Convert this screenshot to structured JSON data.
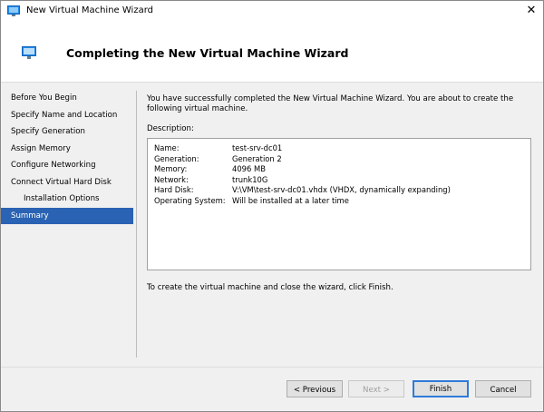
{
  "window": {
    "title": "New Virtual Machine Wizard",
    "close_glyph": "✕"
  },
  "header": {
    "title": "Completing the New Virtual Machine Wizard"
  },
  "sidebar": {
    "items": [
      {
        "label": "Before You Begin"
      },
      {
        "label": "Specify Name and Location"
      },
      {
        "label": "Specify Generation"
      },
      {
        "label": "Assign Memory"
      },
      {
        "label": "Configure Networking"
      },
      {
        "label": "Connect Virtual Hard Disk"
      },
      {
        "label": "Installation Options"
      },
      {
        "label": "Summary"
      }
    ],
    "active_index": 7
  },
  "content": {
    "intro": "You have successfully completed the New Virtual Machine Wizard. You are about to create the following virtual machine.",
    "description_label": "Description:",
    "description": [
      {
        "key": "Name:",
        "value": "test-srv-dc01"
      },
      {
        "key": "Generation:",
        "value": "Generation 2"
      },
      {
        "key": "Memory:",
        "value": "4096 MB"
      },
      {
        "key": "Network:",
        "value": "trunk10G"
      },
      {
        "key": "Hard Disk:",
        "value": "V:\\VM\\test-srv-dc01.vhdx (VHDX, dynamically expanding)"
      },
      {
        "key": "Operating System:",
        "value": "Will be installed at a later time"
      }
    ],
    "finish_note": "To create the virtual machine and close the wizard, click Finish."
  },
  "buttons": {
    "previous": "< Previous",
    "next": "Next >",
    "finish": "Finish",
    "cancel": "Cancel"
  },
  "colors": {
    "accent": "#2a63b3",
    "default_button_border": "#2f7bd9"
  },
  "icons": {
    "title": "vm-window-icon",
    "header": "vm-window-icon",
    "close": "close-icon"
  }
}
